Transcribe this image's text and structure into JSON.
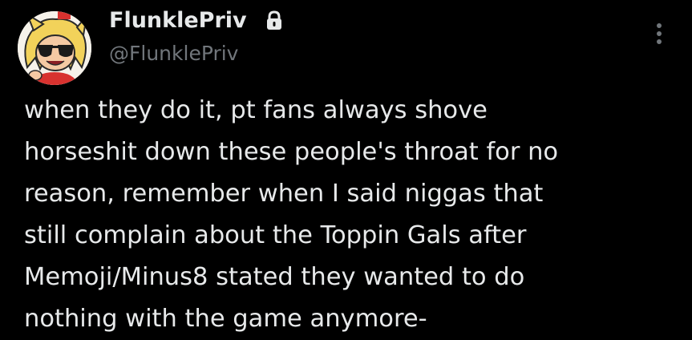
{
  "author": {
    "display_name": "FlunklePriv",
    "handle": "@FlunklePriv",
    "protected_icon": "lock-icon",
    "avatar_icon": "cartoon-avatar-with-sunglasses"
  },
  "menu": {
    "icon": "more-vertical-icon"
  },
  "tweet": {
    "lines": [
      "when they do it, pt fans always shove",
      "horseshit down these people's throat for no",
      "reason, remember when I said niggas that",
      "still complain about the Toppin Gals after",
      "Memoji/Minus8 stated they wanted to do",
      "nothing with the game anymore-"
    ]
  },
  "colors": {
    "background": "#000000",
    "primary_text": "#e7e9ea",
    "secondary_text": "#71767b"
  }
}
